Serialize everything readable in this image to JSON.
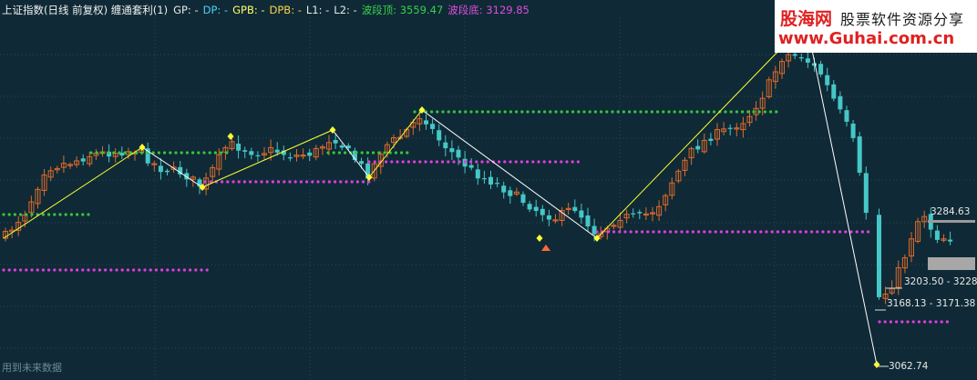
{
  "header": {
    "title": "上证指数(日线 前复权) 缠通套利(1)",
    "gp": "GP: -",
    "dp": "DP: -",
    "gpb": "GPB: -",
    "dpb": "DPB: -",
    "l1": "L1: -",
    "l2": "L2: -",
    "top_label": "波段顶: 3559.47",
    "bottom_label": "波段底: 3129.85"
  },
  "watermark": {
    "brand": "股海网",
    "slogan": "股票软件资源分享",
    "url": "www.Guhai.com.cn"
  },
  "footnote": "用到未来数据",
  "labels": {
    "l_3284": "3284.63",
    "l_3203": "3203.50 - 3228",
    "l_3168": "3168.13 - 3171.38",
    "l_3062": "3062.74"
  },
  "colors": {
    "background": "#0f2a36",
    "up": "#e06a2a",
    "down": "#46c7c7",
    "zigzag_up": "#ffff33",
    "zigzag_down": "#ffffff",
    "resistance": "#37c63d",
    "support": "#e03ee0"
  },
  "chart_data": {
    "type": "candlestick",
    "top_value": 3559.47,
    "bottom_value": 3129.85,
    "annotated_levels": [
      "3284.63",
      "3203.50 - 3228",
      "3168.13 - 3171.38",
      "3062.74"
    ]
  }
}
